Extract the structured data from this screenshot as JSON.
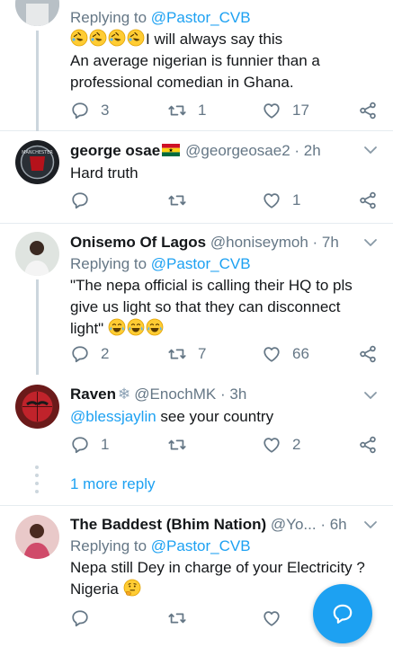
{
  "tweets": [
    {
      "reply_prefix": "Replying to ",
      "reply_handle": "@Pastor_CVB",
      "line1": "I will always say this",
      "line2": "An average nigerian is funnier than a",
      "line3": "professional comedian in Ghana.",
      "replies": "3",
      "retweets": "1",
      "likes": "17",
      "emoji": "rofl"
    },
    {
      "name": "george osae",
      "handle": "@georgeosae2",
      "time": "· 2h",
      "flag": "ghana-flag",
      "text": "Hard truth",
      "likes": "1"
    },
    {
      "name": "Onisemo Of Lagos",
      "handle": "@honiseymoh",
      "time": "· 7h",
      "reply_prefix": "Replying to ",
      "reply_handle": "@Pastor_CVB",
      "line1": "\"The nepa official is calling their HQ to pls",
      "line2": "give us light so that they can disconnect",
      "line3": "light\"",
      "replies": "2",
      "retweets": "7",
      "likes": "66",
      "emoji": "joy"
    },
    {
      "name": "Raven",
      "handle": "@EnochMK",
      "time": "· 3h",
      "text_mention": "@blessjaylin",
      "text_rest": " see your country",
      "replies": "1",
      "likes": "2"
    },
    {
      "name": "The Baddest (Bhim Nation)",
      "handle": "@Yo...",
      "time": "· 6h",
      "reply_prefix": "Replying to ",
      "reply_handle": "@Pastor_CVB",
      "line1": "Nepa still Dey in charge of your Electricity ?",
      "line2": "Nigeria",
      "emoji": "thinking"
    }
  ],
  "more_reply": "1 more reply",
  "colors": {
    "accent": "#1da1f2",
    "muted": "#657786",
    "text": "#14171a",
    "divider": "#e6ecf0"
  },
  "icons": [
    "reply-icon",
    "retweet-icon",
    "like-icon",
    "share-icon",
    "chevron-down-icon",
    "compose-reply-icon"
  ]
}
